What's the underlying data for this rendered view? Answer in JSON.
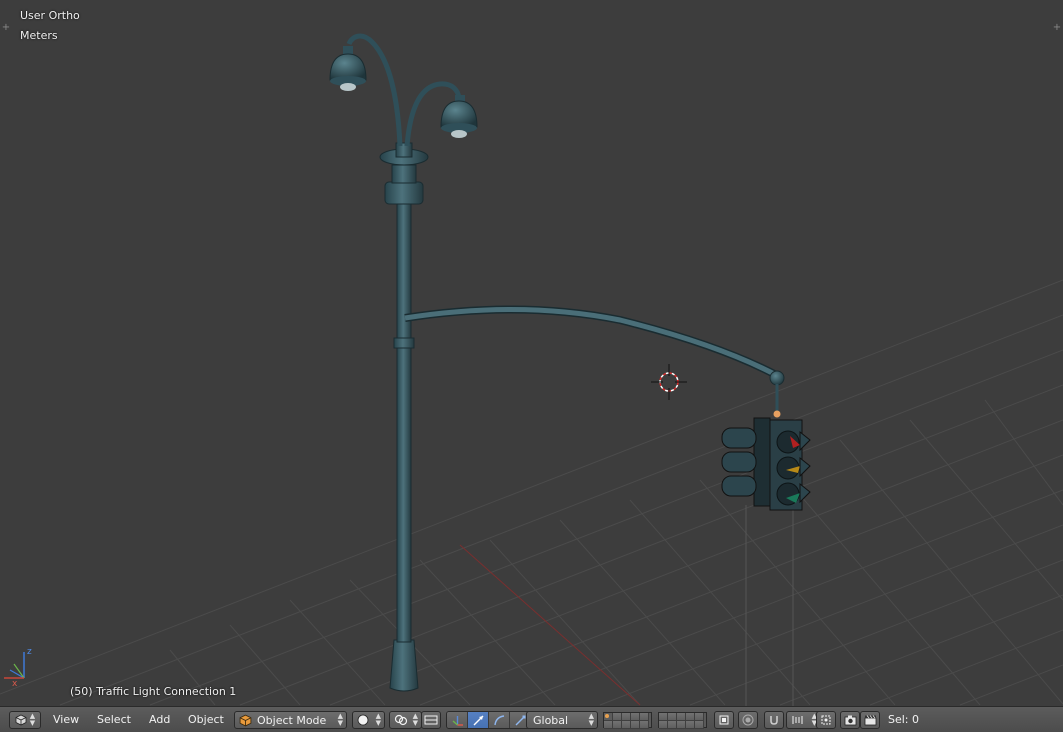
{
  "viewport": {
    "view_name": "User Ortho",
    "units": "Meters",
    "object_info": "(50) Traffic Light Connection 1",
    "axes": {
      "x": "x",
      "z": "z"
    }
  },
  "header": {
    "editor_type_icon": "cube-editor-icon",
    "menus": {
      "view": "View",
      "select": "Select",
      "add": "Add",
      "object": "Object"
    },
    "mode": "Object Mode",
    "orientation": "Global",
    "selection_count": "Sel: 0"
  },
  "colors": {
    "background": "#3d3d3d",
    "grid": "#4a4a4a",
    "model": "#2f4f59",
    "model_highlight": "#4d727c",
    "x_axis": "#8a2e2e",
    "active_tool": "#5680c2"
  }
}
